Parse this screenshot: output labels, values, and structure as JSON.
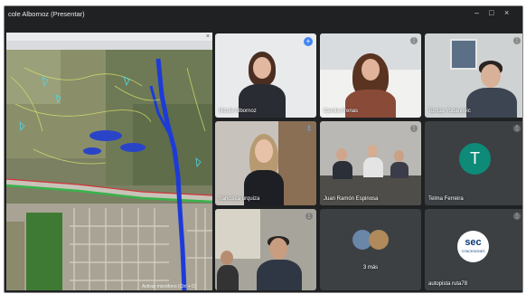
{
  "window": {
    "title": "cole Albornoz (Presentar)"
  },
  "share": {
    "caption": "Activar micrófono (Ctrl + D)"
  },
  "participants": [
    {
      "name": "Nicole Albornoz"
    },
    {
      "name": "Carola Arenas"
    },
    {
      "name": "Tomás Yodanovic"
    },
    {
      "name": "francisca urquiza"
    },
    {
      "name": "Juan Ramón Espinosa"
    },
    {
      "name": "Telma Ferreira",
      "initial": "T"
    },
    {
      "name": ""
    },
    {
      "name": "3 más"
    },
    {
      "name": "autopista ruta78",
      "logo_text": "sec",
      "logo_sub": "CONCESIONES"
    }
  ],
  "colors": {
    "frame": "#1f2123",
    "tile": "#3c4043",
    "avatar": "#0e8a78",
    "pin": "#4285f4"
  }
}
